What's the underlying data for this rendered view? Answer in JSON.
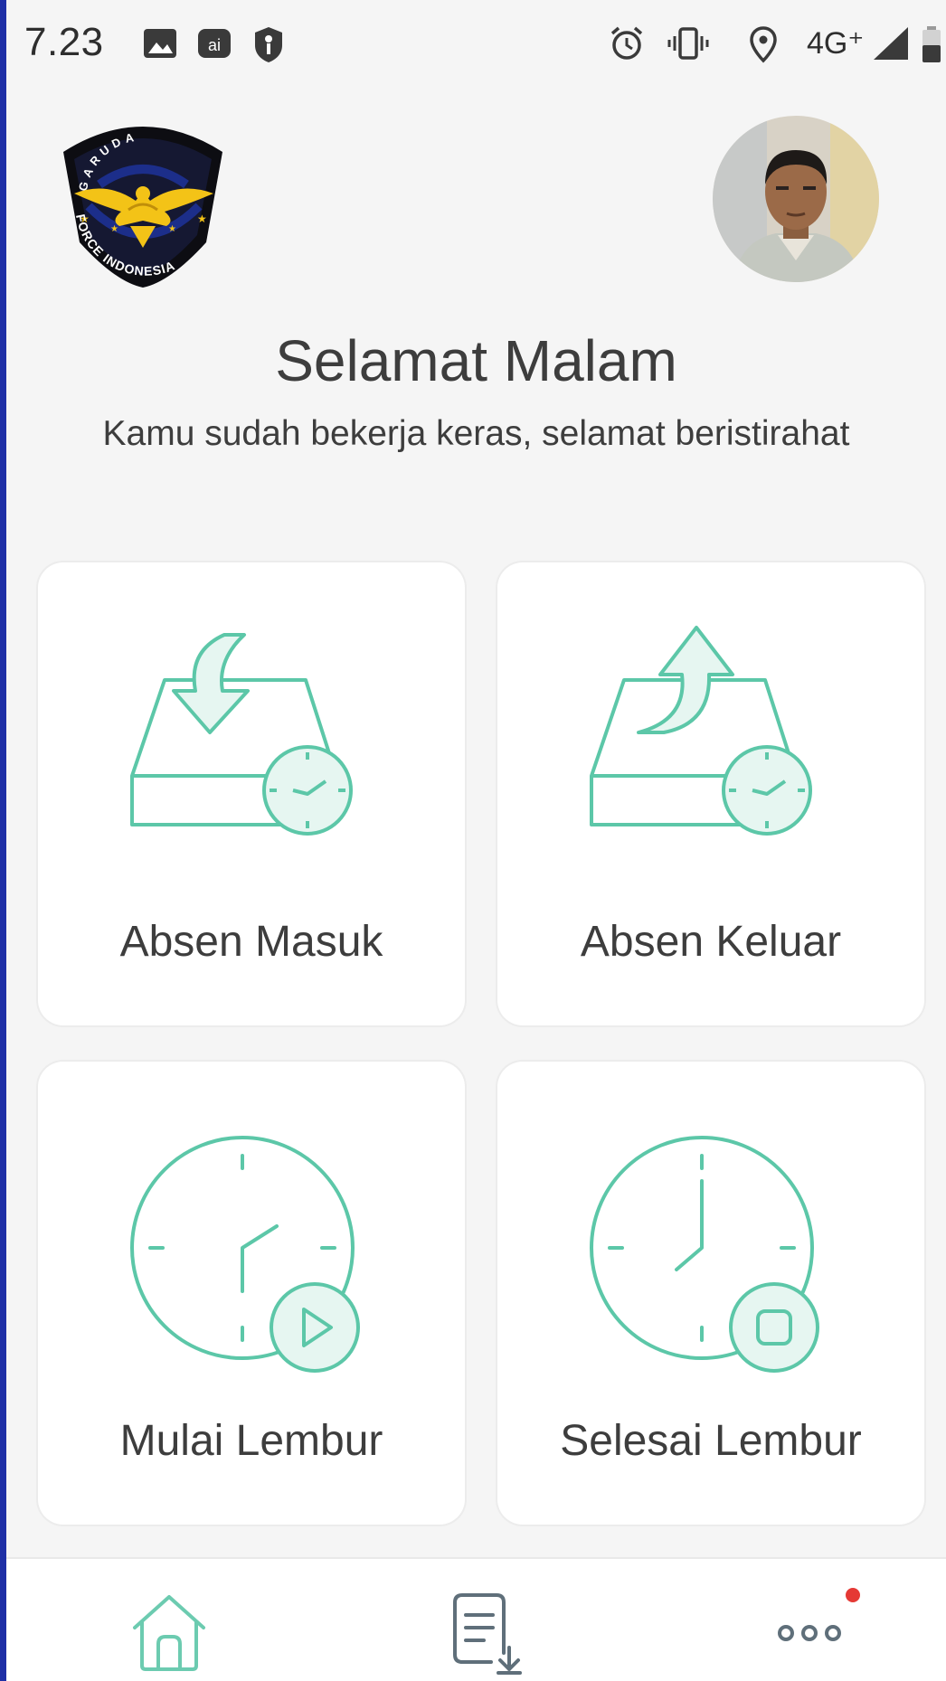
{
  "status_bar": {
    "time": "7.23",
    "network": "4G⁺",
    "icons": [
      "image-icon",
      "app-icon",
      "shield-icon",
      "alarm-icon",
      "vibrate-icon",
      "location-icon",
      "signal-icon",
      "battery-icon"
    ]
  },
  "header": {
    "logo_text_top": "GARUDA",
    "logo_text_bottom": "FORCE INDONESIA",
    "greeting": "Selamat Malam",
    "subtitle": "Kamu sudah bekerja keras, selamat beristirahat"
  },
  "menu": {
    "absen_masuk": "Absen Masuk",
    "absen_keluar": "Absen Keluar",
    "mulai_lembur": "Mulai Lembur",
    "selesai_lembur": "Selesai Lembur"
  },
  "bottom_nav": {
    "items": [
      "home-icon",
      "report-download-icon",
      "more-icon"
    ]
  },
  "colors": {
    "accent": "#5cc7a8",
    "accent_fill": "#e6f6f1",
    "text": "#3d3d3d",
    "nav_icon": "#5f6f7a",
    "notification": "#e53935"
  }
}
